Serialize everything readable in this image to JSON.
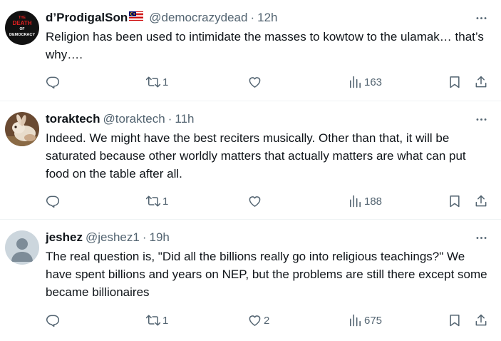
{
  "tweets": [
    {
      "name": "d’ProdigalSon",
      "handle": "@democrazydead",
      "separator": "·",
      "time": "12h",
      "avatar_text": [
        "THE",
        "DEATH",
        "OF",
        "DEMOCRACY"
      ],
      "avatar_icon": "democracy-logo-avatar",
      "flag_icon": "malaysia-flag-icon",
      "text": "Religion has been used to intimidate the masses to kowtow to the ulamak… that’s why….",
      "replies": "",
      "retweets": "1",
      "likes": "",
      "views": "163"
    },
    {
      "name": "toraktech",
      "handle": "@toraktech",
      "separator": "·",
      "time": "11h",
      "avatar_icon": "rabbit-photo-avatar",
      "text": "Indeed. We might have the best reciters musically. Other than that, it will be saturated because other worldly matters that actually matters are what can put food on the table after all.",
      "replies": "",
      "retweets": "1",
      "likes": "",
      "views": "188"
    },
    {
      "name": "jeshez",
      "handle": "@jeshez1",
      "separator": "·",
      "time": "19h",
      "avatar_icon": "default-user-avatar",
      "text": "The real question is, \"Did all the billions really go into religious teachings?\" We have spent billions and years on NEP, but the problems are still there except some became billionaires",
      "replies": "",
      "retweets": "1",
      "likes": "2",
      "views": "675"
    }
  ],
  "colors": {
    "text": "#0f1419",
    "secondary": "#536471",
    "divider": "#eff3f4",
    "default_avatar_bg": "#ccd6dd"
  },
  "icons": {
    "more": "more-horizontal-icon",
    "reply": "reply-icon",
    "retweet": "retweet-icon",
    "like": "heart-icon",
    "views": "views-chart-icon",
    "bookmark": "bookmark-icon",
    "share": "share-icon"
  }
}
